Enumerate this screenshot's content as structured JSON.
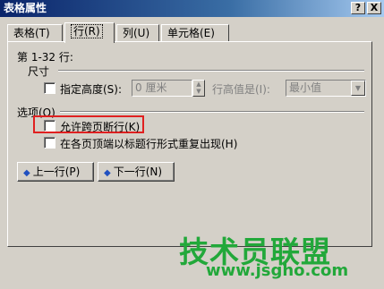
{
  "window": {
    "title": "表格属性",
    "help_btn": "?",
    "close_btn": "X"
  },
  "tabs": [
    {
      "label": "表格(T)"
    },
    {
      "label": "行(R)"
    },
    {
      "label": "列(U)"
    },
    {
      "label": "单元格(E)"
    }
  ],
  "row_range": "第 1-32 行:",
  "size_group": {
    "label": "尺寸",
    "specify_height_label": "指定高度(S):",
    "height_value": "0 厘米",
    "row_height_is_label": "行高值是(I):",
    "row_height_option": "最小值"
  },
  "options_group": {
    "label": "选项(O)",
    "allow_break_label": "允许跨页断行(K)",
    "repeat_header_label": "在各页顶端以标题行形式重复出现(H)"
  },
  "buttons": {
    "prev_row": "上一行(P)",
    "next_row": "下一行(N)"
  },
  "watermark": {
    "text": "技术员联盟",
    "url": "www.jsgho.com"
  },
  "colors": {
    "highlight": "#e02020",
    "watermark": "#22a83a",
    "titlebar": "#0a246a"
  }
}
